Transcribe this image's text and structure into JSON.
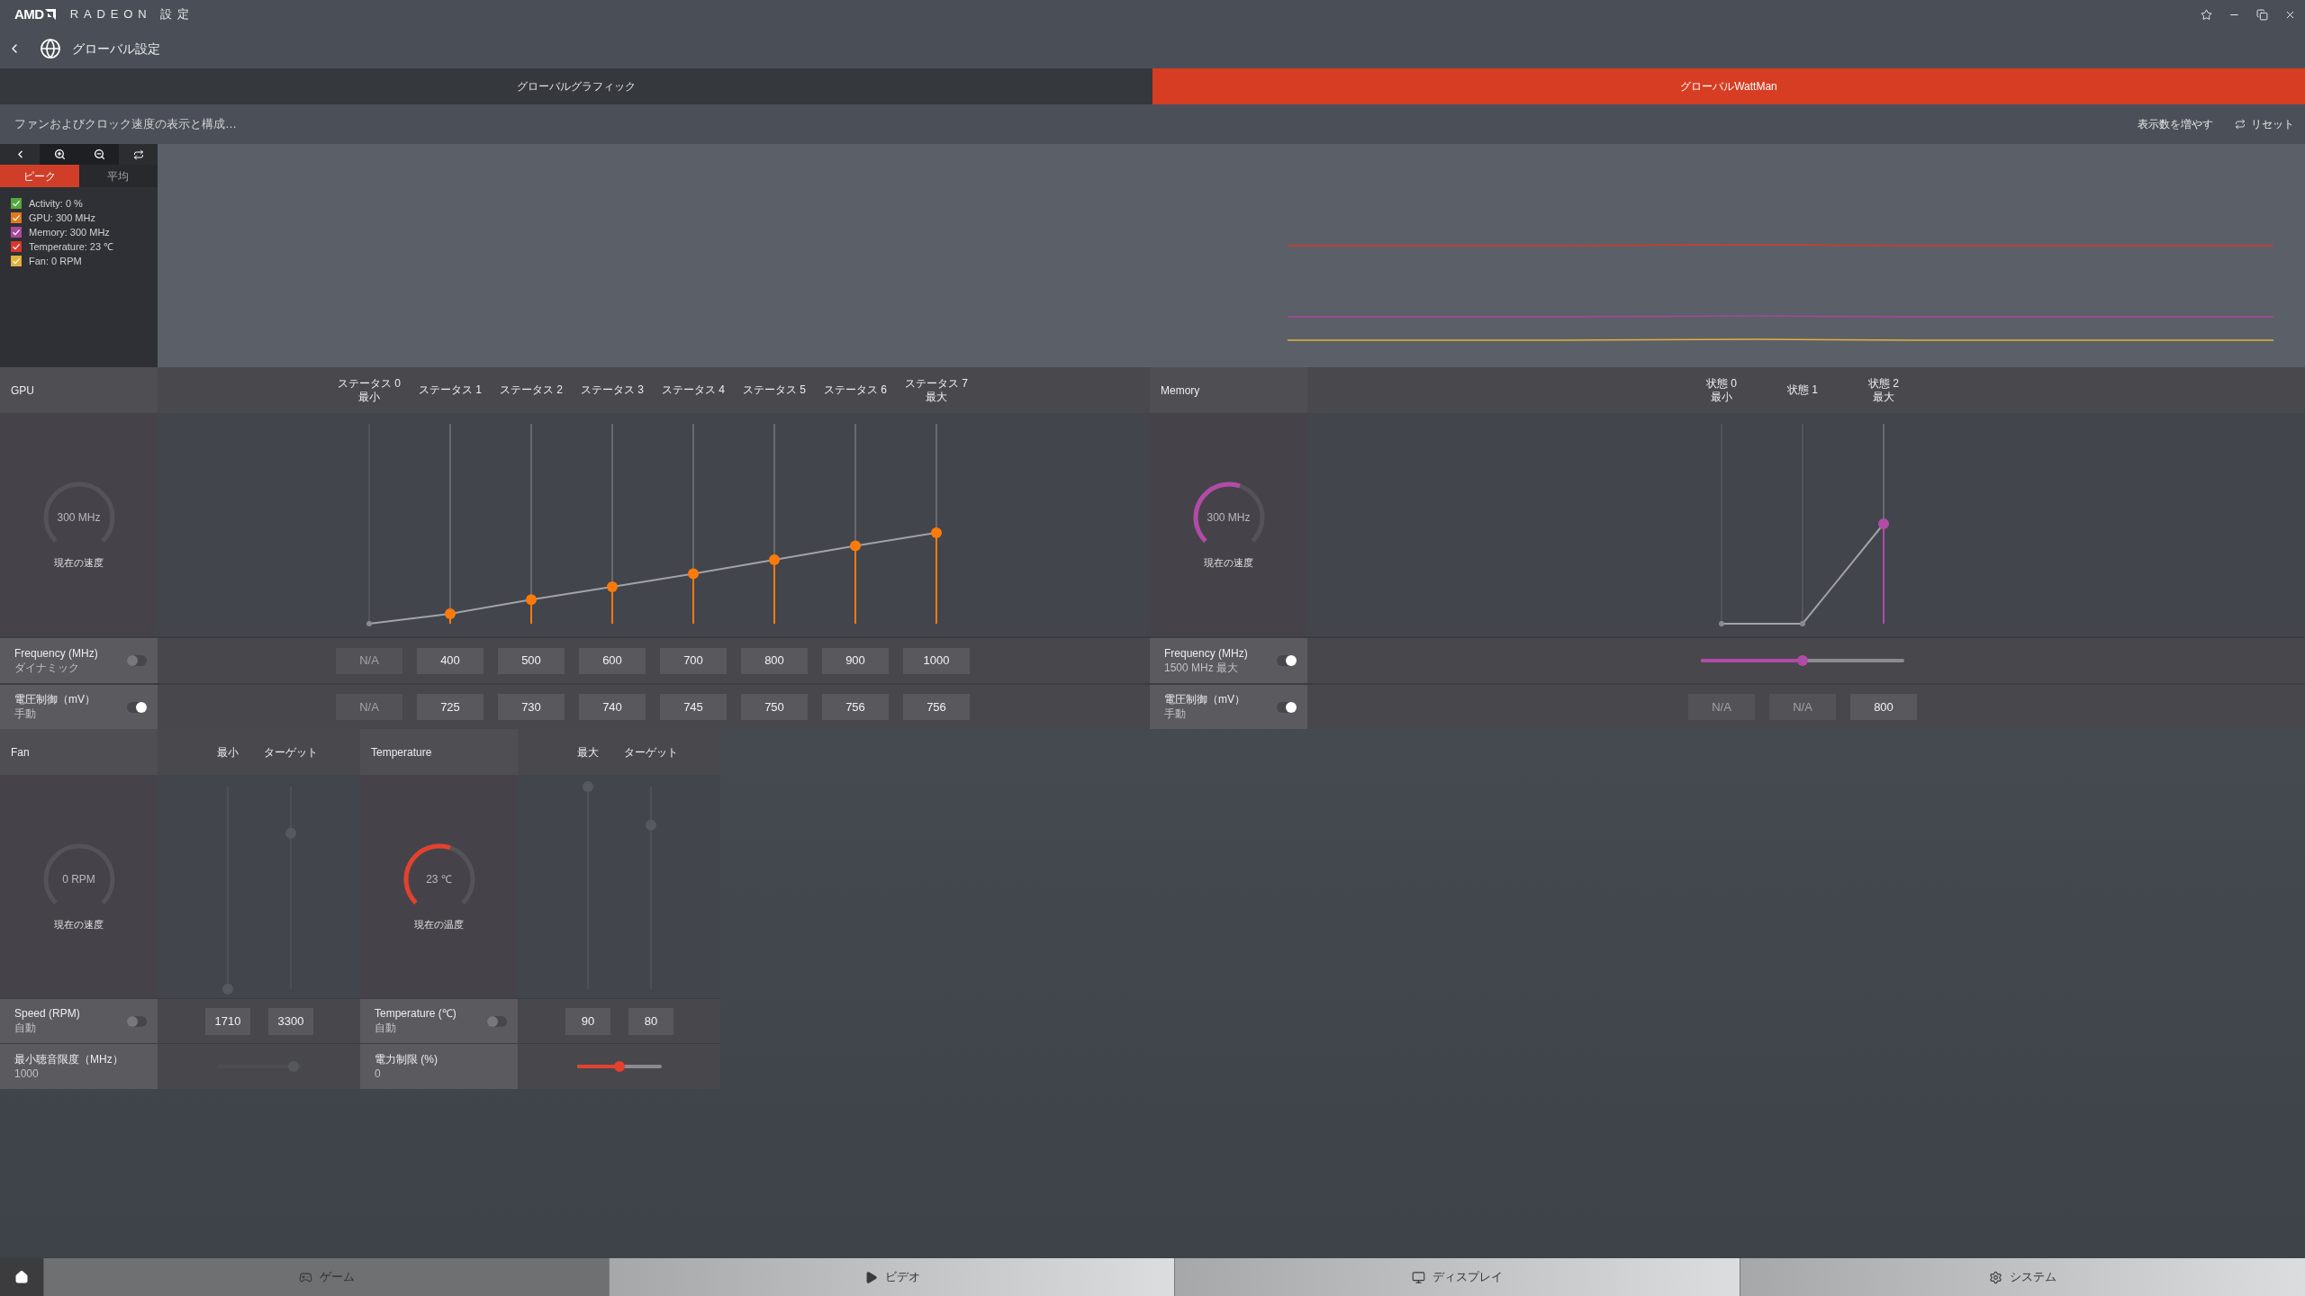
{
  "window": {
    "logo": "AMD",
    "title": "RADEON 設定"
  },
  "nav": {
    "title": "グローバル設定"
  },
  "tabs": [
    {
      "label": "グローバルグラフィック",
      "selected": false
    },
    {
      "label": "グローバルWattMan",
      "selected": true
    }
  ],
  "toolbar": {
    "description": "ファンおよびクロック速度の表示と構成…",
    "show_more": "表示数を増やす",
    "reset": "リセット"
  },
  "monitor": {
    "tabs": [
      {
        "label": "ピーク",
        "selected": true
      },
      {
        "label": "平均",
        "selected": false
      }
    ],
    "legend": [
      {
        "label": "Activity: 0 %",
        "checked": true,
        "color": "#53a93f"
      },
      {
        "label": "GPU: 300 MHz",
        "checked": true,
        "color": "#e0781e"
      },
      {
        "label": "Memory: 300 MHz",
        "checked": true,
        "color": "#a8479d"
      },
      {
        "label": "Temperature: 23 ℃",
        "checked": true,
        "color": "#d8372c"
      },
      {
        "label": "Fan: 0 RPM",
        "checked": true,
        "color": "#e2b03a"
      }
    ]
  },
  "gpu": {
    "title": "GPU",
    "gauge": {
      "value": "300 MHz",
      "caption": "現在の速度"
    },
    "states": [
      {
        "label": "ステータス 0",
        "sublabel": "最小",
        "disabled": true,
        "level": 0
      },
      {
        "label": "ステータス 1",
        "disabled": false,
        "level": 0.05
      },
      {
        "label": "ステータス 2",
        "disabled": false,
        "level": 0.12
      },
      {
        "label": "ステータス 3",
        "disabled": false,
        "level": 0.185
      },
      {
        "label": "ステータス 4",
        "disabled": false,
        "level": 0.25
      },
      {
        "label": "ステータス 5",
        "disabled": false,
        "level": 0.32
      },
      {
        "label": "ステータス 6",
        "disabled": false,
        "level": 0.39
      },
      {
        "label": "ステータス 7",
        "sublabel": "最大",
        "disabled": false,
        "level": 0.455
      }
    ],
    "rows": [
      {
        "label": "Frequency (MHz)",
        "mode": "ダイナミック",
        "on": false,
        "values": [
          "N/A",
          "400",
          "500",
          "600",
          "700",
          "800",
          "900",
          "1000"
        ]
      },
      {
        "label": "電圧制御（mV）",
        "mode": "手動",
        "on": true,
        "values": [
          "N/A",
          "725",
          "730",
          "740",
          "745",
          "750",
          "756",
          "756"
        ]
      }
    ]
  },
  "memory": {
    "title": "Memory",
    "gauge": {
      "value": "300 MHz",
      "caption": "現在の速度",
      "level": 0.57
    },
    "states": [
      {
        "label": "状態 0",
        "sublabel": "最小",
        "disabled": true,
        "level": 0
      },
      {
        "label": "状態 1",
        "disabled": true,
        "level": 0
      },
      {
        "label": "状態 2",
        "sublabel": "最大",
        "disabled": false,
        "level": 0.5
      }
    ],
    "frequency": {
      "label": "Frequency (MHz)",
      "mode": "1500 MHz 最大",
      "on": true,
      "level": 0.5
    },
    "voltage": {
      "label": "電圧制御（mV）",
      "mode": "手動",
      "on": true,
      "values": [
        "N/A",
        "N/A",
        "800"
      ]
    }
  },
  "fan": {
    "title": "Fan",
    "columns": [
      {
        "label": "最小",
        "level": 0
      },
      {
        "label": "ターゲット",
        "level": 0.77
      }
    ],
    "gauge": {
      "value": "0 RPM",
      "caption": "現在の速度"
    },
    "speed": {
      "label": "Speed (RPM)",
      "mode": "自動",
      "on": false,
      "values": [
        "1710",
        "3300"
      ]
    },
    "min_acoustic_limit": {
      "label": "最小聴音限度（MHz）",
      "value": "1000",
      "level": 0.96,
      "disabled": true
    }
  },
  "temperature": {
    "title": "Temperature",
    "columns": [
      {
        "label": "最大",
        "level": 1
      },
      {
        "label": "ターゲット",
        "level": 0.81
      }
    ],
    "gauge": {
      "value": "23 ℃",
      "caption": "現在の温度",
      "level": 0.57
    },
    "temperature_control": {
      "label": "Temperature (℃)",
      "mode": "自動",
      "on": false,
      "values": [
        "90",
        "80"
      ]
    },
    "power_limit": {
      "label": "電力制限 (%)",
      "value": "0",
      "level": 0.5,
      "disabled": false
    }
  },
  "bottom_nav": [
    {
      "label": "ゲーム",
      "selected": true
    },
    {
      "label": "ビデオ",
      "selected": false
    },
    {
      "label": "ディスプレイ",
      "selected": false
    },
    {
      "label": "システム",
      "selected": false
    }
  ]
}
